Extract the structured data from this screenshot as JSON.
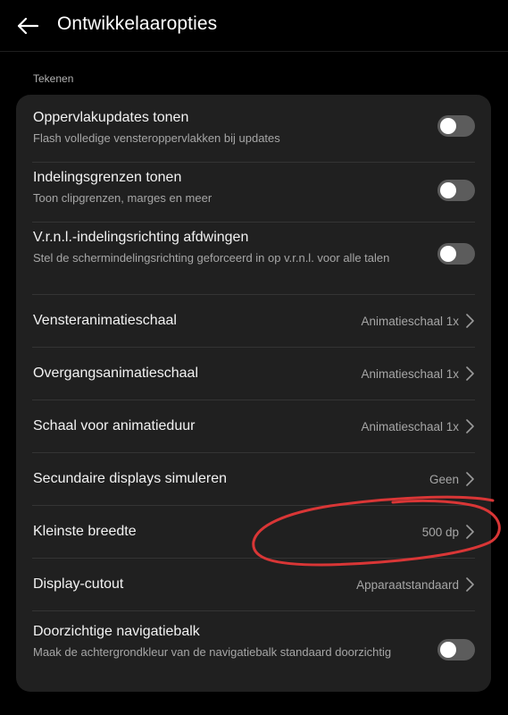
{
  "header": {
    "title": "Ontwikkelaaropties",
    "back_icon": "arrow-left-icon"
  },
  "section": {
    "label": "Tekenen"
  },
  "rows": [
    {
      "title": "Oppervlakupdates tonen",
      "subtitle": "Flash volledige vensteroppervlakken bij updates",
      "toggle": false
    },
    {
      "title": "Indelingsgrenzen tonen",
      "subtitle": "Toon clipgrenzen, marges en meer",
      "toggle": false
    },
    {
      "title": "V.r.n.l.-indelingsrichting afdwingen",
      "subtitle": "Stel de schermindelingsrichting geforceerd in op v.r.n.l. voor alle talen",
      "toggle": false
    },
    {
      "title": "Vensteranimatieschaal",
      "value": "Animatieschaal 1x"
    },
    {
      "title": "Overgangsanimatieschaal",
      "value": "Animatieschaal 1x"
    },
    {
      "title": "Schaal voor animatieduur",
      "value": "Animatieschaal 1x"
    },
    {
      "title": "Secundaire displays simuleren",
      "value": "Geen"
    },
    {
      "title": "Kleinste breedte",
      "value": "500 dp"
    },
    {
      "title": "Display-cutout",
      "value": "Apparaatstandaard"
    },
    {
      "title": "Doorzichtige navigatiebalk",
      "subtitle": "Maak de achtergrondkleur van de navigatiebalk standaard doorzichtig",
      "toggle": false
    }
  ],
  "colors": {
    "background": "#000000",
    "card": "#202020",
    "toggle_off": "#5c5c5c",
    "annotation": "#d93636"
  }
}
